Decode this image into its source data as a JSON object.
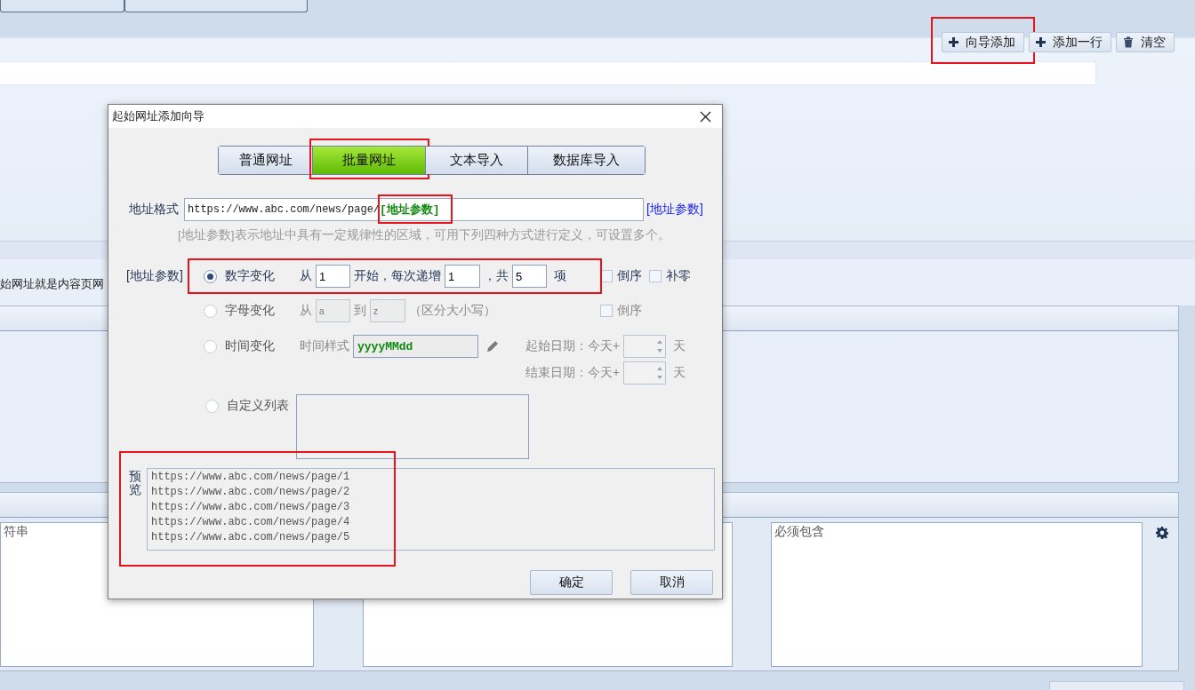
{
  "toolbar": [
    {
      "kind": "plus",
      "label": "向导添加",
      "highlighted": true
    },
    {
      "kind": "plus",
      "label": "添加一行",
      "highlighted": false
    },
    {
      "kind": "trash",
      "label": "清空",
      "highlighted": false
    }
  ],
  "option_text": "始网址就是内容页网",
  "filters": [
    {
      "text": "符串"
    },
    {
      "text": "必须包含"
    }
  ],
  "dialog": {
    "title": "起始网址添加向导",
    "tabs": [
      {
        "label": "普通网址",
        "selected": false,
        "highlighted": false
      },
      {
        "label": "批量网址",
        "selected": true,
        "highlighted": true
      },
      {
        "label": "文本导入",
        "selected": false,
        "highlighted": false
      },
      {
        "label": "数据库导入",
        "selected": false,
        "highlighted": false
      }
    ],
    "address": {
      "label": "地址格式",
      "prefix": "https://www.abc.com/news/page/",
      "token": "[地址参数]",
      "token_highlighted": true,
      "link": "[地址参数]"
    },
    "hint": "[地址参数]表示地址中具有一定规律性的区域，可用下列四种方式进行定义，可设置多个。",
    "param_label": "[地址参数]",
    "number_mode": {
      "label": "数字变化",
      "selected": true,
      "highlighted": true,
      "from_label": "从",
      "start": "1",
      "step_label": "开始，每次递增",
      "step": "1",
      "count_label": "，共",
      "count": "5",
      "unit": "项",
      "options": [
        {
          "label": "倒序",
          "checked": false
        },
        {
          "label": "补零",
          "checked": false
        }
      ]
    },
    "letter_mode": {
      "label": "字母变化",
      "selected": false,
      "from_label": "从",
      "from": "a",
      "to_label": "到",
      "to": "z",
      "note": "（区分大小写）",
      "options": [
        {
          "label": "倒序",
          "checked": false
        }
      ]
    },
    "time_mode": {
      "label": "时间变化",
      "selected": false,
      "format_label": "时间样式",
      "format": "yyyyMMdd",
      "start_label": "起始日期：今天+",
      "start_unit": "天",
      "end_label": "结束日期：今天+",
      "end_unit": "天"
    },
    "list_mode": {
      "label": "自定义列表",
      "selected": false
    },
    "preview": {
      "label": "预览",
      "highlighted": true,
      "lines": [
        "https://www.abc.com/news/page/1",
        "https://www.abc.com/news/page/2",
        "https://www.abc.com/news/page/3",
        "https://www.abc.com/news/page/4",
        "https://www.abc.com/news/page/5"
      ]
    },
    "buttons": [
      "确定",
      "取消"
    ]
  }
}
